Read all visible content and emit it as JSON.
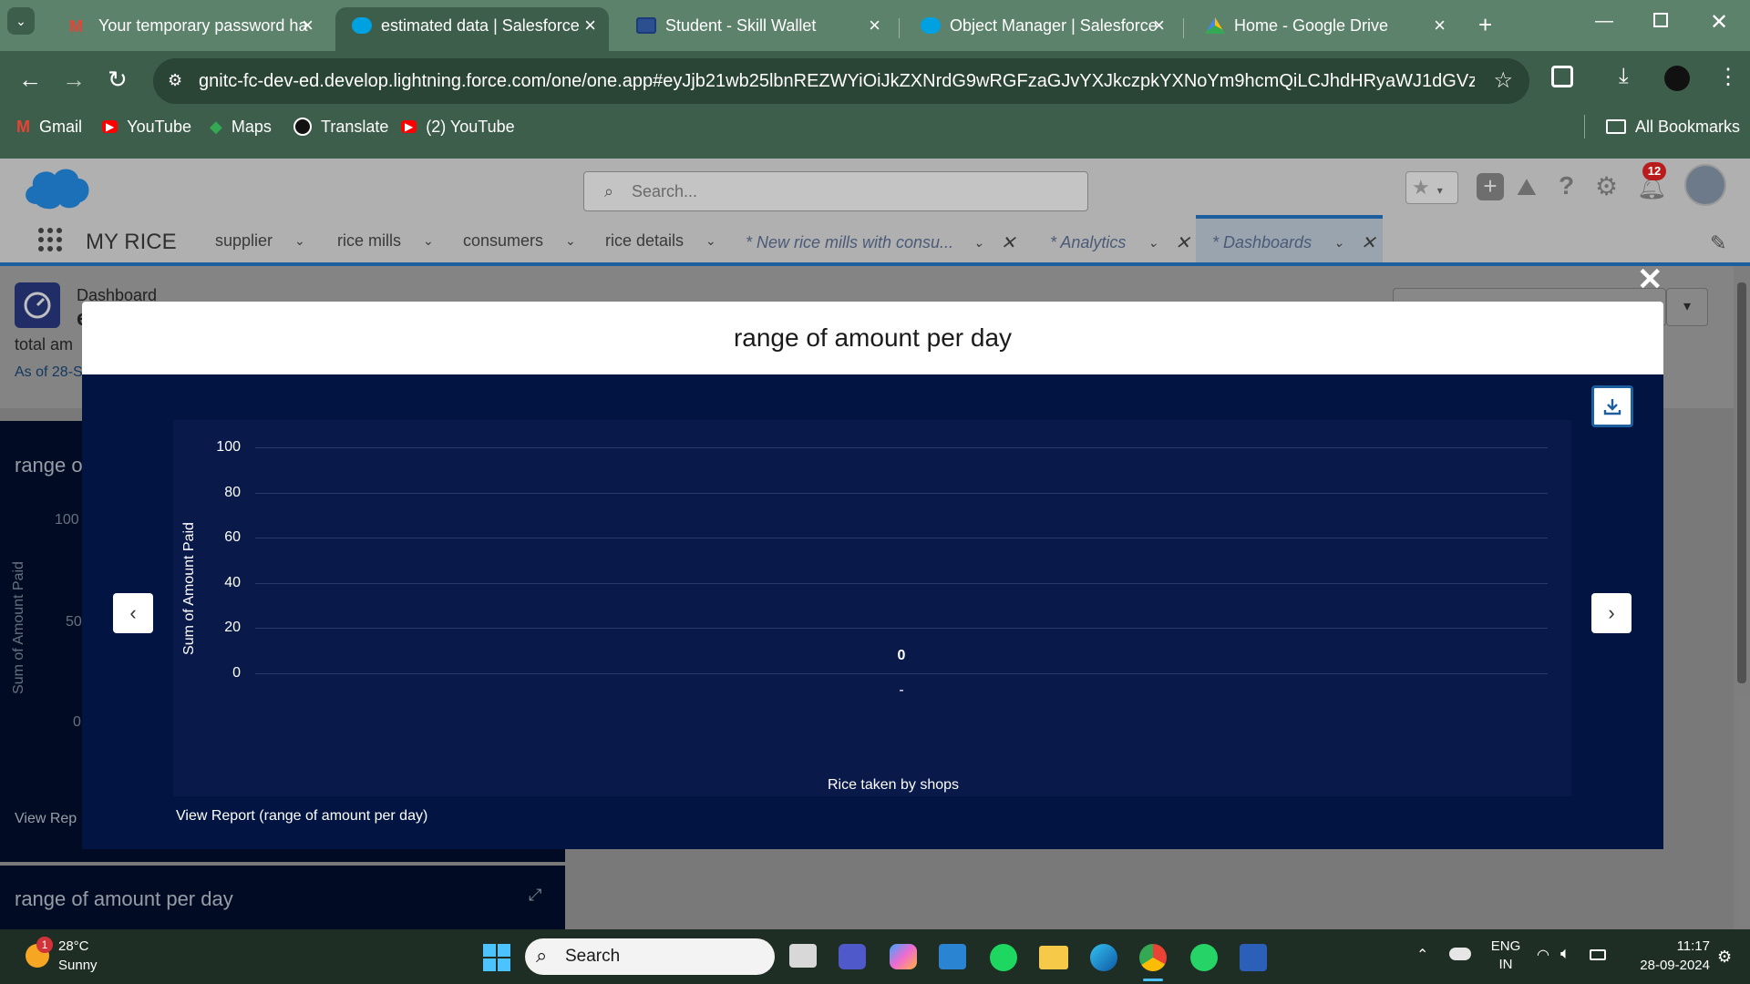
{
  "browser": {
    "tabs": [
      {
        "title": "Your temporary password ha",
        "icon": "gmail-icon"
      },
      {
        "title": "estimated data | Salesforce",
        "icon": "salesforce-cloud-icon"
      },
      {
        "title": "Student - Skill Wallet",
        "icon": "skill-wallet-icon"
      },
      {
        "title": "Object Manager | Salesforce",
        "icon": "salesforce-cloud-icon"
      },
      {
        "title": "Home - Google Drive",
        "icon": "google-drive-icon"
      }
    ],
    "active_tab_index": 1,
    "url": "gnitc-fc-dev-ed.develop.lightning.force.com/one/one.app#eyJjb21wb25lbnREZWYiOiJkZXNrdG9wRGFzaGJvYXJkczpkYXNoYm9hcmQiLCJhdHRyaWJ1dGVzIjp7ImR...",
    "bookmarks": [
      "Gmail",
      "YouTube",
      "Maps",
      "Translate",
      "(2) YouTube"
    ],
    "all_bookmarks": "All Bookmarks"
  },
  "salesforce": {
    "search_placeholder": "Search...",
    "app_name": "MY RICE",
    "nav_items": [
      {
        "label": "supplier",
        "italic": false,
        "closable": false
      },
      {
        "label": "rice mills",
        "italic": false,
        "closable": false
      },
      {
        "label": "consumers",
        "italic": false,
        "closable": false
      },
      {
        "label": "rice details",
        "italic": false,
        "closable": false
      },
      {
        "label": "* New rice mills with consu...",
        "italic": true,
        "closable": true
      },
      {
        "label": "* Analytics",
        "italic": true,
        "closable": true
      },
      {
        "label": "* Dashboards",
        "italic": true,
        "closable": true
      }
    ],
    "notification_count": "12",
    "dashboard_label": "Dashboard",
    "dashboard_title_initial": "e",
    "subtitle": "total am",
    "as_of": "As of 28-S",
    "bg_card_title": "range o",
    "bg_y_label": "Sum of Amount Paid",
    "bg_y_ticks": [
      "100",
      "50",
      "0"
    ],
    "bg_view_report": "View Rep",
    "bg_bottom_card_title": "range of amount per day"
  },
  "modal": {
    "title": "range of amount per day",
    "view_report": "View Report (range of amount per day)"
  },
  "chart_data": {
    "type": "bar",
    "categories": [
      "-"
    ],
    "values": [
      0
    ],
    "data_labels": [
      "0"
    ],
    "ylabel": "Sum of Amount Paid",
    "xlabel": "Rice taken by shops",
    "ylim": [
      0,
      100
    ],
    "yticks": [
      "100",
      "80",
      "60",
      "40",
      "20",
      "0"
    ],
    "grid": true
  },
  "taskbar": {
    "weather_temp": "28°C",
    "weather_desc": "Sunny",
    "weather_badge": "1",
    "search_label": "Search",
    "lang": "ENG",
    "region": "IN",
    "time": "11:17",
    "date": "28-09-2024"
  }
}
